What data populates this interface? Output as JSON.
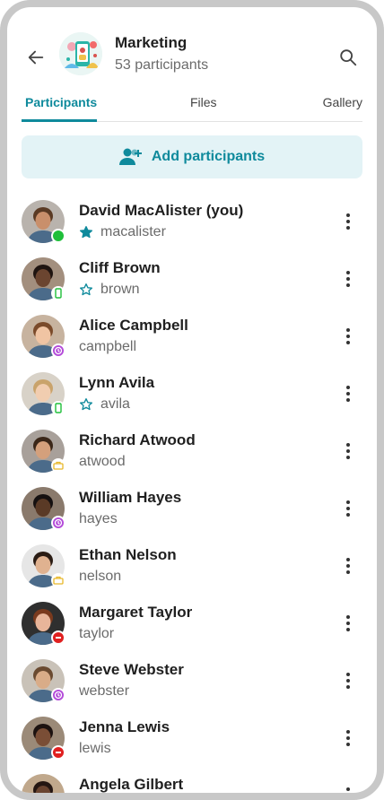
{
  "header": {
    "title": "Marketing",
    "subtitle": "53 participants",
    "back_icon": "arrow-left-icon",
    "search_icon": "search-icon"
  },
  "tabs": [
    {
      "label": "Participants",
      "active": true
    },
    {
      "label": "Files",
      "active": false
    },
    {
      "label": "Gallery",
      "active": false
    }
  ],
  "add_button": {
    "label": "Add participants",
    "icon": "add-person-icon"
  },
  "colors": {
    "accent": "#0f8a9c",
    "online": "#1fbf3a",
    "away": "#b34ad9",
    "dnd": "#e02020",
    "mobile": "#1fbf3a",
    "busy_meeting": "#e8b82a"
  },
  "participants": [
    {
      "name": "David MacAlister (you)",
      "username": "macalister",
      "star": "filled",
      "status": "online"
    },
    {
      "name": "Cliff Brown",
      "username": "brown",
      "star": "outline",
      "status": "mobile"
    },
    {
      "name": "Alice Campbell",
      "username": "campbell",
      "star": "none",
      "status": "away"
    },
    {
      "name": "Lynn Avila",
      "username": "avila",
      "star": "outline",
      "status": "mobile"
    },
    {
      "name": "Richard Atwood",
      "username": "atwood",
      "star": "none",
      "status": "meeting"
    },
    {
      "name": "William Hayes",
      "username": "hayes",
      "star": "none",
      "status": "away"
    },
    {
      "name": "Ethan Nelson",
      "username": "nelson",
      "star": "none",
      "status": "meeting"
    },
    {
      "name": "Margaret Taylor",
      "username": "taylor",
      "star": "none",
      "status": "dnd"
    },
    {
      "name": "Steve Webster",
      "username": "webster",
      "star": "none",
      "status": "away"
    },
    {
      "name": "Jenna Lewis",
      "username": "lewis",
      "star": "none",
      "status": "dnd"
    },
    {
      "name": "Angela Gilbert",
      "username": "",
      "star": "none",
      "status": "none"
    }
  ]
}
